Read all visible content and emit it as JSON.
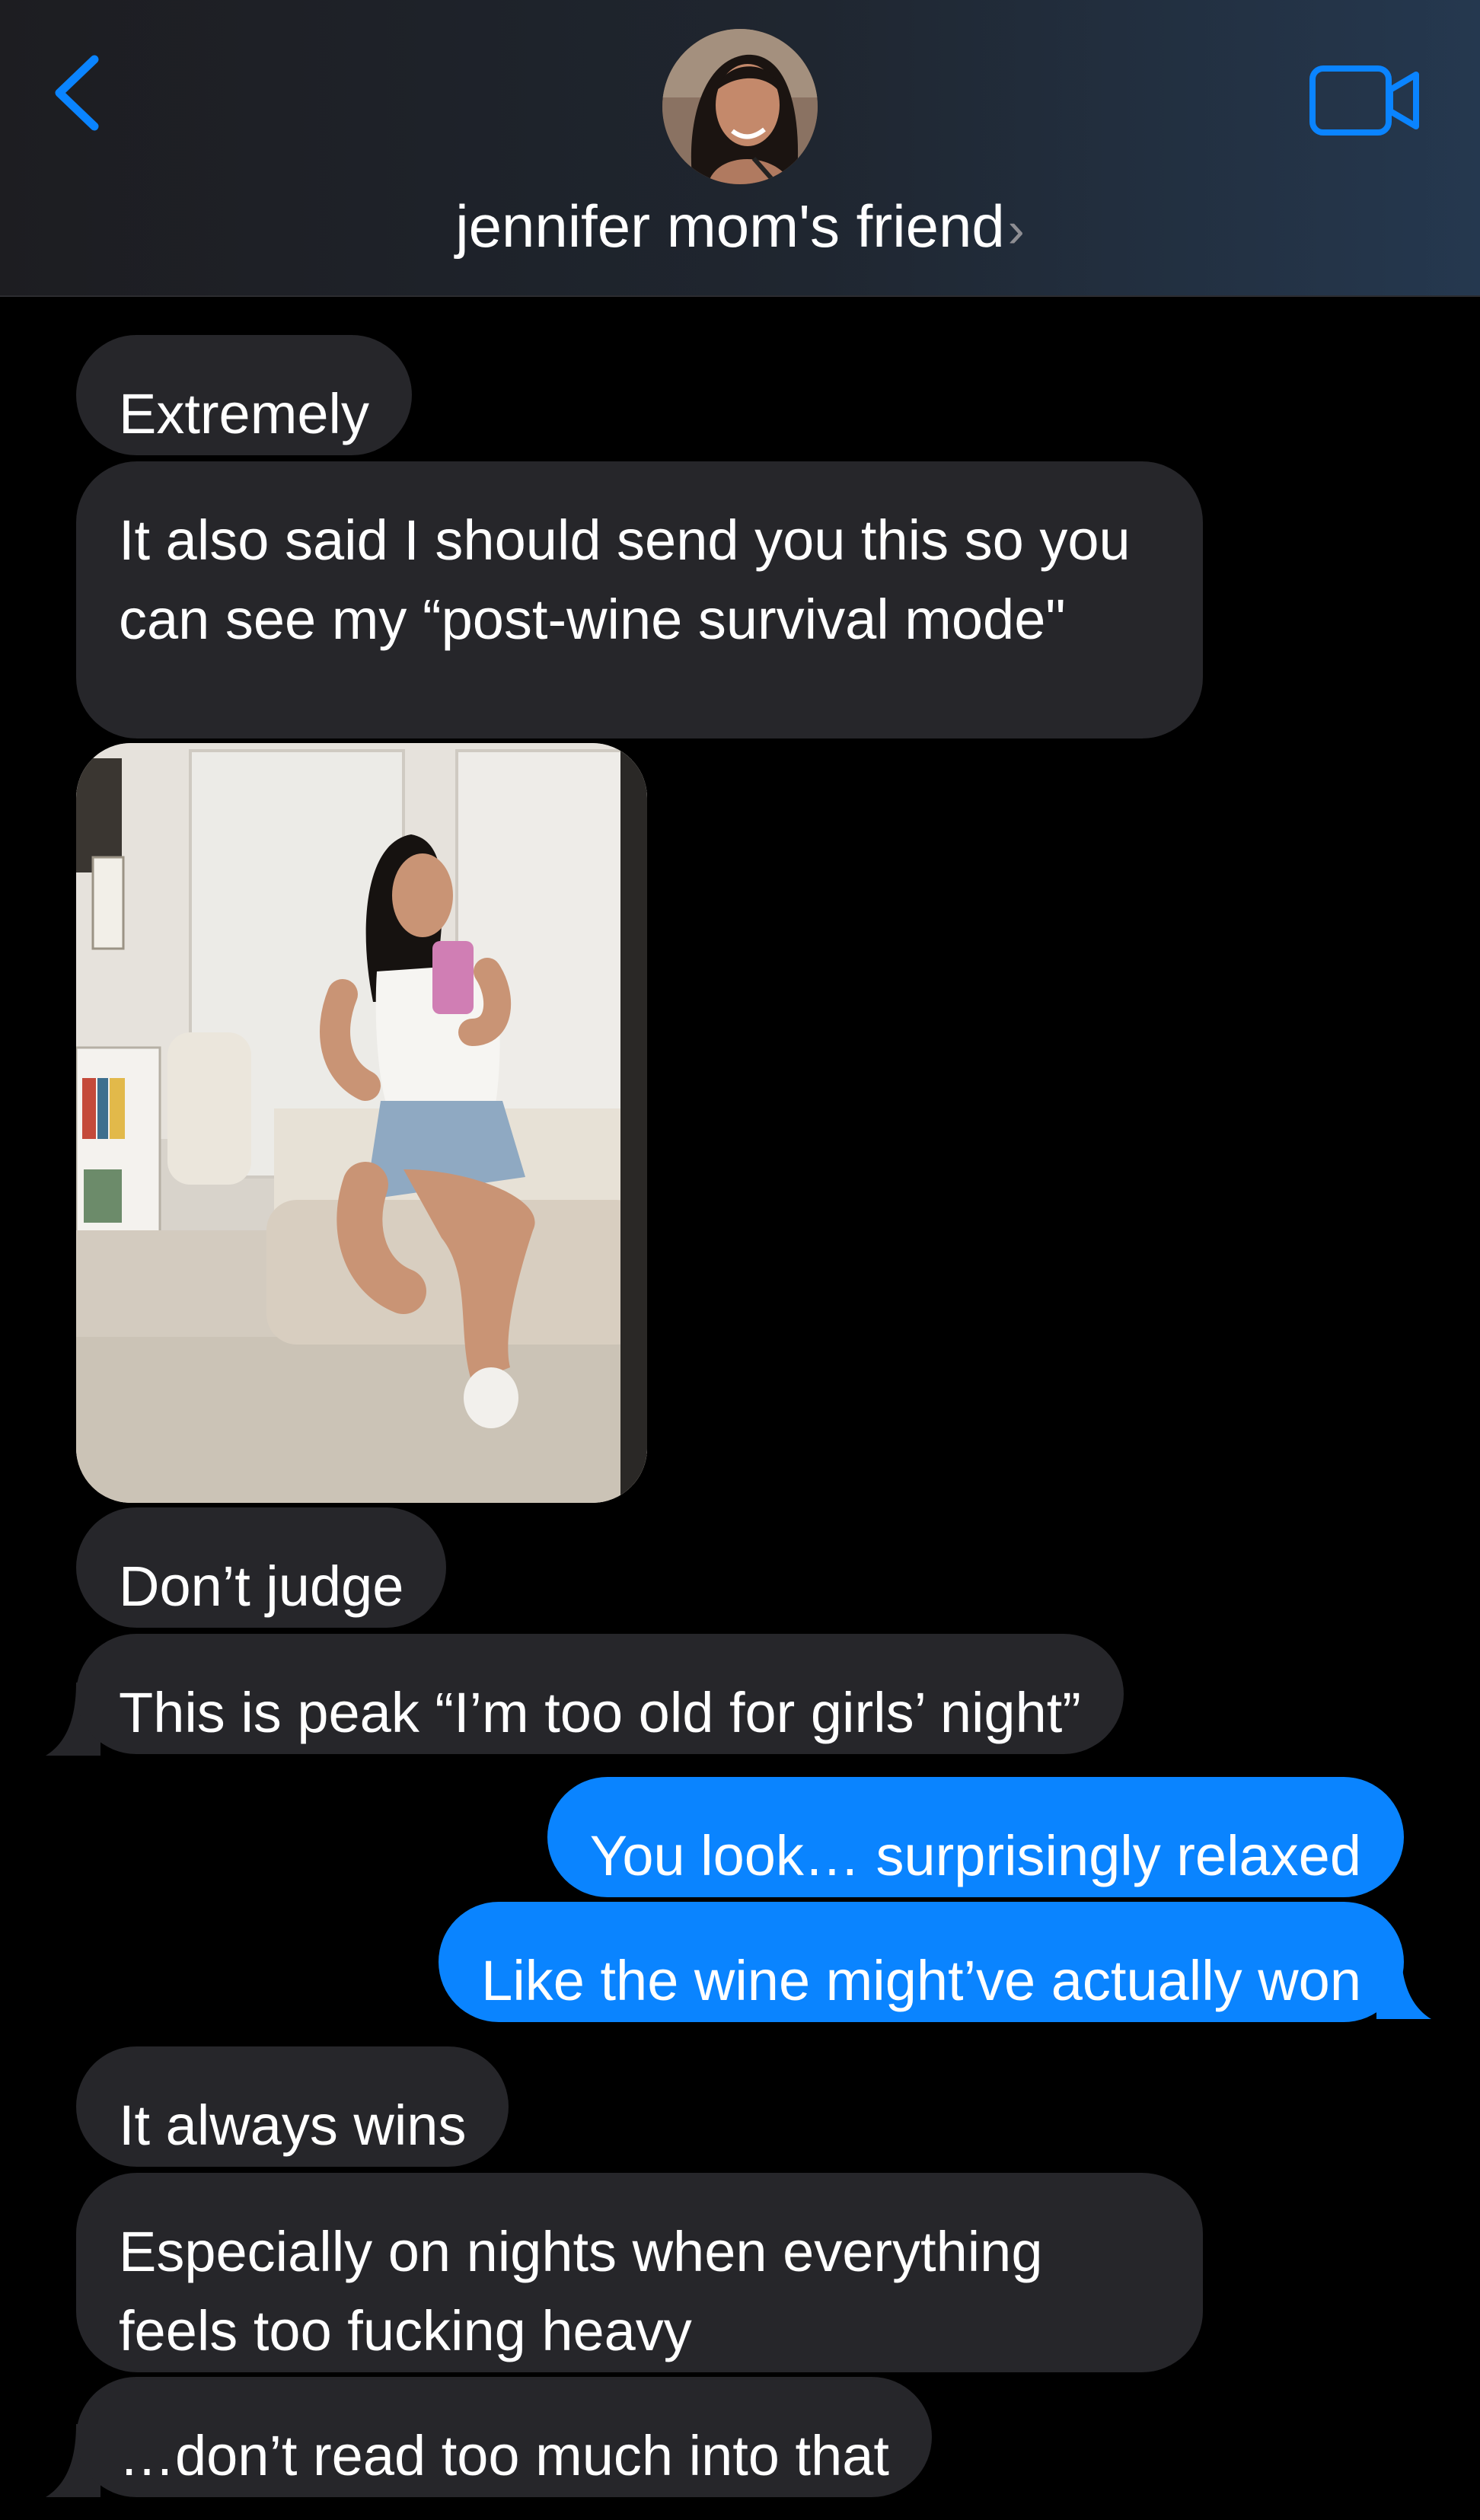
{
  "header": {
    "contact_name": "jennifer mom's friend",
    "chevron": "›",
    "back_icon": "chevron-left-icon",
    "video_icon": "video-camera-icon",
    "accent_color": "#0a84ff"
  },
  "messages": [
    {
      "from": "them",
      "text": "Extremely"
    },
    {
      "from": "them",
      "text": "It also said I should send you this so you can see my “post-wine survival mode\""
    },
    {
      "from": "them",
      "type": "photo"
    },
    {
      "from": "them",
      "text": "Don’t judge"
    },
    {
      "from": "them",
      "text": "This is peak “I’m too old for girls’ night”"
    },
    {
      "from": "me",
      "text": "You look… surprisingly relaxed"
    },
    {
      "from": "me",
      "text": "Like the wine might’ve actually won"
    },
    {
      "from": "them",
      "text": "It always wins"
    },
    {
      "from": "them",
      "text": "Especially on nights when everything feels too fucking heavy"
    },
    {
      "from": "them",
      "text": "…don’t read too much into that"
    }
  ],
  "colors": {
    "incoming_bubble": "#26262a",
    "outgoing_bubble": "#0a84ff",
    "background": "#000000"
  }
}
